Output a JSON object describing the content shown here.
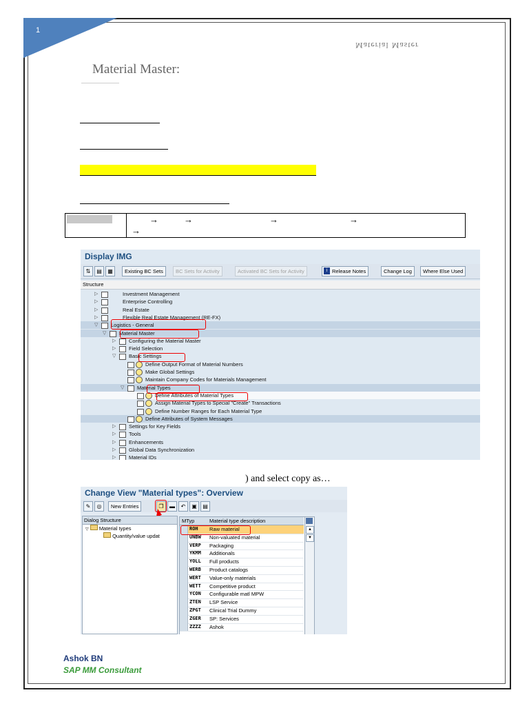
{
  "page": {
    "number": "1",
    "header_right": "Material Master"
  },
  "document": {
    "title": "Material Master:",
    "body_text": ") and select copy as…",
    "arrow": "→"
  },
  "display_img": {
    "title": "Display IMG",
    "toolbar": [
      "Existing BC Sets",
      "BC Sets for Activity",
      "Activated BC Sets for Activity",
      "Release Notes",
      "Change Log",
      "Where Else Used"
    ],
    "structure_label": "Structure",
    "tree": [
      {
        "label": "Investment Management",
        "level": 0
      },
      {
        "label": "Enterprise Controlling",
        "level": 0
      },
      {
        "label": "Real Estate",
        "level": 0
      },
      {
        "label": "Flexible Real Estate Management (RE-FX)",
        "level": 0
      },
      {
        "label": "Logistics - General",
        "level": 0
      },
      {
        "label": "Material Master",
        "level": 1
      },
      {
        "label": "Configuring the Material Master",
        "level": 2
      },
      {
        "label": "Field Selection",
        "level": 2
      },
      {
        "label": "Basic Settings",
        "level": 2
      },
      {
        "label": "Define Output Format of Material Numbers",
        "level": 3
      },
      {
        "label": "Make Global Settings",
        "level": 3
      },
      {
        "label": "Maintain Company Codes for Materials Management",
        "level": 3
      },
      {
        "label": "Material Types",
        "level": 3
      },
      {
        "label": "Define Attributes of Material Types",
        "level": 4
      },
      {
        "label": "Assign Material Types to Special \"Create\" Transactions",
        "level": 4
      },
      {
        "label": "Define Number Ranges for Each Material Type",
        "level": 4
      },
      {
        "label": "Define Attributes of System Messages",
        "level": 3
      },
      {
        "label": "Settings for Key Fields",
        "level": 2
      },
      {
        "label": "Tools",
        "level": 2
      },
      {
        "label": "Enhancements",
        "level": 2
      },
      {
        "label": "Global Data Synchronization",
        "level": 2
      },
      {
        "label": "Material IDs",
        "level": 2
      }
    ]
  },
  "change_view": {
    "title": "Change View \"Material types\": Overview",
    "new_entries": "New Entries",
    "dialog_structure": "Dialog Structure",
    "dialog_items": [
      "Material types",
      "Quantity/value updat"
    ],
    "col_mtyp": "MTyp",
    "col_desc": "Material type description",
    "rows": [
      {
        "code": "ROH",
        "desc": "Raw material"
      },
      {
        "code": "UNBW",
        "desc": "Non-valuated material"
      },
      {
        "code": "VERP",
        "desc": "Packaging"
      },
      {
        "code": "YKMM",
        "desc": "Additionals"
      },
      {
        "code": "YOLL",
        "desc": "Full products"
      },
      {
        "code": "WERB",
        "desc": "Product catalogs"
      },
      {
        "code": "WERT",
        "desc": "Value-only materials"
      },
      {
        "code": "WETT",
        "desc": "Competitive product"
      },
      {
        "code": "YCON",
        "desc": "Configurable matl MPW"
      },
      {
        "code": "ZTEN",
        "desc": "LSP Service"
      },
      {
        "code": "ZPGT",
        "desc": "Clinical Trial Dummy"
      },
      {
        "code": "ZGER",
        "desc": "SP: Services"
      },
      {
        "code": "ZZZZ",
        "desc": "Ashok"
      }
    ]
  },
  "footer": {
    "name": "Ashok BN",
    "role": "SAP MM Consultant"
  },
  "colors": {
    "accent": "#4f81bd",
    "highlight": "#ffff00",
    "sap_title": "#1d4f80",
    "annotation": "#ee0000"
  }
}
